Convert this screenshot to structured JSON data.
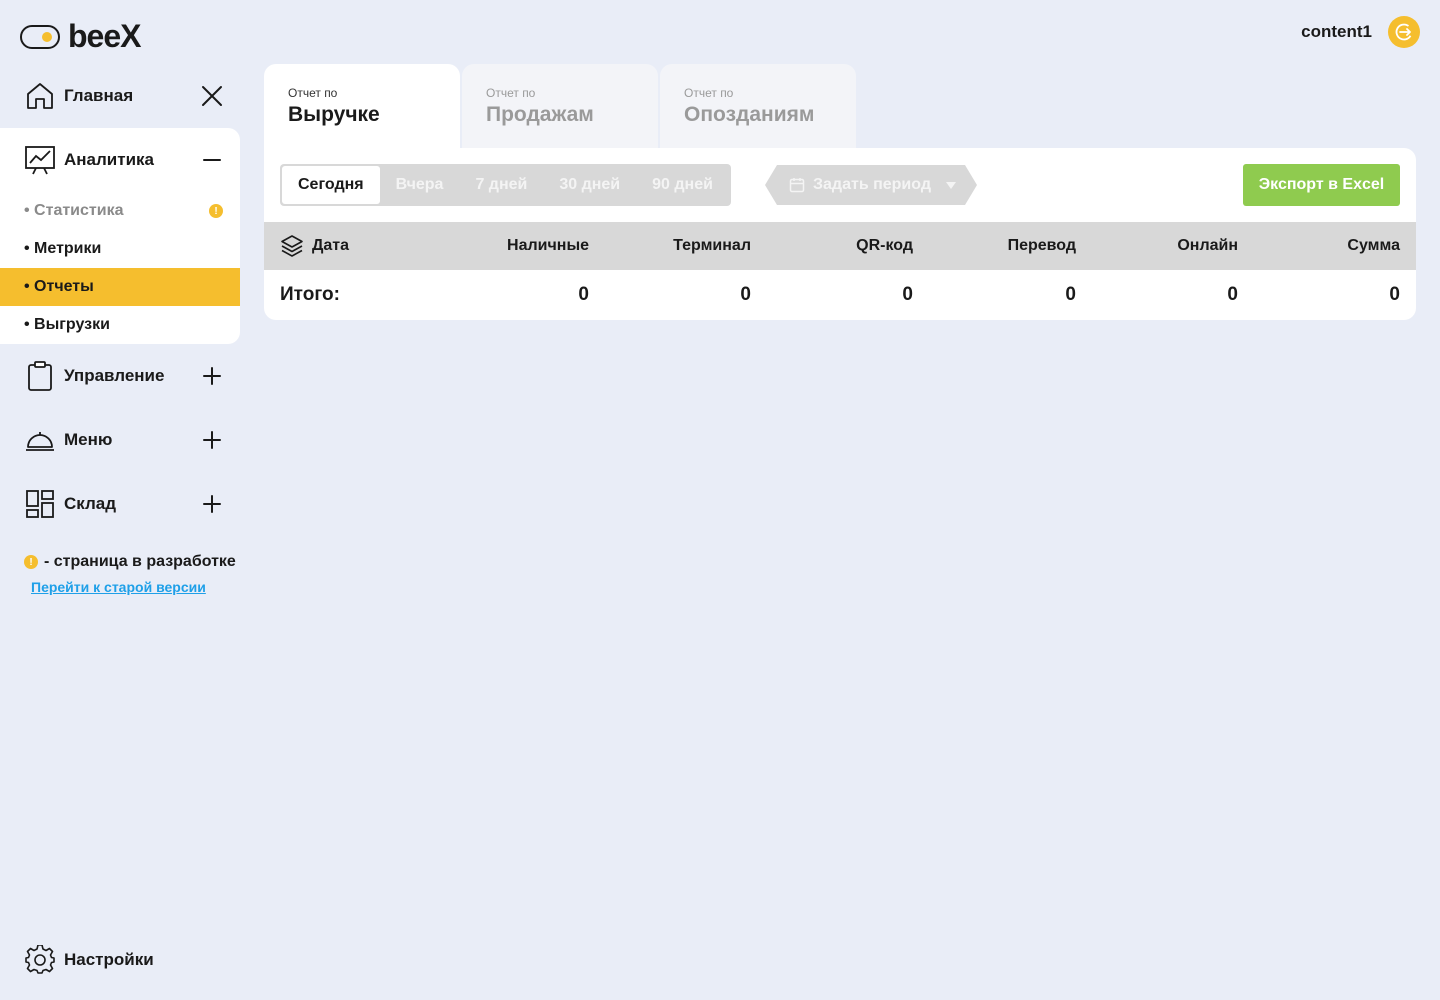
{
  "header": {
    "logo_text": "beeX",
    "username": "content1"
  },
  "sidebar": {
    "main": {
      "label": "Главная"
    },
    "analytics": {
      "label": "Аналитика",
      "items": [
        {
          "label": "Статистика",
          "state": "in-development"
        },
        {
          "label": "Метрики"
        },
        {
          "label": "Отчеты",
          "state": "active"
        },
        {
          "label": "Выгрузки"
        }
      ]
    },
    "management": {
      "label": "Управление"
    },
    "menu": {
      "label": "Меню"
    },
    "warehouse": {
      "label": "Склад"
    },
    "legend_badge": "!",
    "legend_text": "- страница в разработке",
    "old_version_link": "Перейти к старой версии",
    "settings": {
      "label": "Настройки"
    }
  },
  "tabs": [
    {
      "prefix": "Отчет по",
      "title": "Выручке",
      "active": true
    },
    {
      "prefix": "Отчет по",
      "title": "Продажам",
      "active": false
    },
    {
      "prefix": "Отчет по",
      "title": "Опозданиям",
      "active": false
    }
  ],
  "periods": [
    {
      "label": "Сегодня",
      "active": true
    },
    {
      "label": "Вчера"
    },
    {
      "label": "7 дней"
    },
    {
      "label": "30 дней"
    },
    {
      "label": "90 дней"
    }
  ],
  "date_range": {
    "label": "Задать период"
  },
  "export_button": "Экспорт в Excel",
  "table": {
    "columns": [
      "Дата",
      "Наличные",
      "Терминал",
      "QR-код",
      "Перевод",
      "Онлайн",
      "Сумма"
    ],
    "total_label": "Итого:",
    "totals": [
      "0",
      "0",
      "0",
      "0",
      "0",
      "0"
    ]
  },
  "colors": {
    "accent": "#f5be2e",
    "background": "#e9edf7",
    "export": "#8fcb4f",
    "link": "#1fa0e8"
  }
}
